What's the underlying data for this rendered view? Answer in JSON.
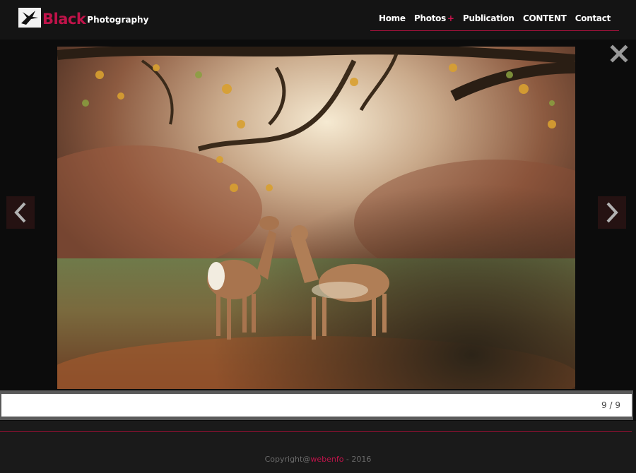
{
  "brand": {
    "name_accent": "Black",
    "name_rest": "Photography",
    "accent_color": "#c0134a"
  },
  "nav": {
    "items": [
      {
        "label": "Home"
      },
      {
        "label": "Photos",
        "has_submenu": true,
        "submenu_marker": "+"
      },
      {
        "label": "Publication"
      },
      {
        "label": "CONTENT"
      },
      {
        "label": "Contact"
      }
    ]
  },
  "lightbox": {
    "counter": "9 / 9",
    "close_icon": "close-icon",
    "prev_icon": "chevron-left-icon",
    "next_icon": "chevron-right-icon"
  },
  "footer": {
    "prefix": "Copyright@",
    "link": "webenfo",
    "suffix": " - 2016"
  }
}
